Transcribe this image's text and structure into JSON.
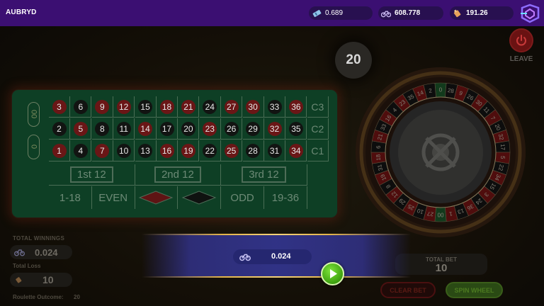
{
  "header": {
    "username": "AUBRYD",
    "balance_1": "0.689",
    "balance_2": "608.778",
    "balance_3": "191.26"
  },
  "timer": "20",
  "leave_label": "LEAVE",
  "table": {
    "row_top": [
      [
        "3",
        "red"
      ],
      [
        "6",
        "blk"
      ],
      [
        "9",
        "red"
      ],
      [
        "12",
        "red"
      ],
      [
        "15",
        "blk"
      ],
      [
        "18",
        "red"
      ],
      [
        "21",
        "red"
      ],
      [
        "24",
        "blk"
      ],
      [
        "27",
        "red"
      ],
      [
        "30",
        "red"
      ],
      [
        "33",
        "blk"
      ],
      [
        "36",
        "red"
      ]
    ],
    "row_mid": [
      [
        "2",
        "blk"
      ],
      [
        "5",
        "red"
      ],
      [
        "8",
        "blk"
      ],
      [
        "11",
        "blk"
      ],
      [
        "14",
        "red"
      ],
      [
        "17",
        "blk"
      ],
      [
        "20",
        "blk"
      ],
      [
        "23",
        "red"
      ],
      [
        "26",
        "blk"
      ],
      [
        "29",
        "blk"
      ],
      [
        "32",
        "red"
      ],
      [
        "35",
        "blk"
      ]
    ],
    "row_bot": [
      [
        "1",
        "red"
      ],
      [
        "4",
        "blk"
      ],
      [
        "7",
        "red"
      ],
      [
        "10",
        "blk"
      ],
      [
        "13",
        "blk"
      ],
      [
        "16",
        "red"
      ],
      [
        "19",
        "red"
      ],
      [
        "22",
        "blk"
      ],
      [
        "25",
        "red"
      ],
      [
        "28",
        "blk"
      ],
      [
        "31",
        "blk"
      ],
      [
        "34",
        "red"
      ]
    ],
    "columns": [
      "C3",
      "C2",
      "C1"
    ],
    "zeros": [
      "00",
      "0"
    ],
    "dozens": [
      "1st 12",
      "2nd 12",
      "3rd 12"
    ],
    "outside": [
      "1-18",
      "EVEN",
      "ODD",
      "19-36"
    ]
  },
  "wheel_numbers": [
    "0",
    "28",
    "9",
    "26",
    "30",
    "11",
    "7",
    "20",
    "32",
    "17",
    "5",
    "22",
    "34",
    "15",
    "3",
    "24",
    "36",
    "13",
    "1",
    "00",
    "27",
    "10",
    "25",
    "29",
    "12",
    "8",
    "19",
    "31",
    "18",
    "6",
    "21",
    "33",
    "16",
    "4",
    "23",
    "35",
    "14",
    "2"
  ],
  "stats": {
    "total_winnings_label": "TOTAL WINNINGS",
    "total_winnings_value": "0.024",
    "total_loss_label": "Total Loss",
    "total_loss_value": "10",
    "outcome_label": "Roulette Outcome:",
    "outcome_value": "20"
  },
  "bet": {
    "total_bet_label": "TOTAL BET",
    "total_bet_value": "10",
    "clear_label": "CLEAR BET",
    "spin_label": "SPIN WHEEL"
  },
  "win_banner": {
    "amount": "0.024"
  },
  "colors": {
    "topbar": "#3b0f72",
    "felt": "#0e3f25",
    "red_pocket": "#6a1616",
    "play_green": "#3da10f"
  }
}
